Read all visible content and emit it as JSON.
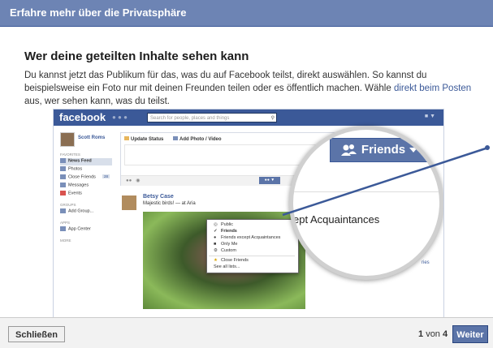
{
  "dialog": {
    "title": "Erfahre mehr über die Privatsphäre"
  },
  "main": {
    "heading": "Wer deine geteilten Inhalte sehen kann",
    "description_part1": "Du kannst jetzt das Publikum für das, was du auf Facebook teilst, direkt auswählen. So kannst du beispielsweise ein Foto nur mit deinen Freunden teilen oder es öffentlich machen. Wähle ",
    "description_link": "direkt beim Posten",
    "description_part2": " aus, wer sehen kann, was du teilst."
  },
  "screenshot": {
    "logo": "facebook",
    "search_placeholder": "Search for people, places and things",
    "user_name": "Scott Roms",
    "favorites_label": "FAVORITES",
    "sidebar_items": [
      {
        "label": "News Feed",
        "icon": "news-feed-icon"
      },
      {
        "label": "Photos",
        "icon": "photos-icon"
      },
      {
        "label": "Close Friends",
        "icon": "close-friends-icon",
        "count": "28"
      },
      {
        "label": "Messages",
        "icon": "messages-icon"
      },
      {
        "label": "Events",
        "icon": "events-icon"
      }
    ],
    "groups_label": "GROUPS",
    "group_item": "Add Group...",
    "apps_label": "APPS",
    "app_item": "App Center",
    "more_label": "MORE",
    "update_status": "Update Status",
    "add_photo": "Add Photo / Video",
    "post_author": "Betsy Case",
    "post_text": "Majestic birds! — at Aria",
    "audience_options": [
      {
        "label": "Public",
        "icon": "globe-icon"
      },
      {
        "label": "Friends",
        "icon": "friends-icon",
        "checked": true
      },
      {
        "label": "Friends except Acquaintances",
        "icon": "friends-icon"
      },
      {
        "label": "Only Me",
        "icon": "lock-icon"
      },
      {
        "label": "Custom",
        "icon": "gear-icon"
      },
      {
        "label": "Close Friends",
        "icon": "list-icon"
      },
      {
        "label": "See all lists...",
        "icon": ""
      }
    ],
    "magnifier_button": "Friends",
    "magnifier_text": "ept Acquaintances",
    "side_text": "ries"
  },
  "footer": {
    "close_label": "Schließen",
    "pager_current": "1",
    "pager_of": "von",
    "pager_total": "4",
    "next_label": "Weiter"
  },
  "colors": {
    "titlebar": "#6d84b4",
    "facebook_blue": "#3b5998",
    "button_blue": "#5b74a8"
  }
}
